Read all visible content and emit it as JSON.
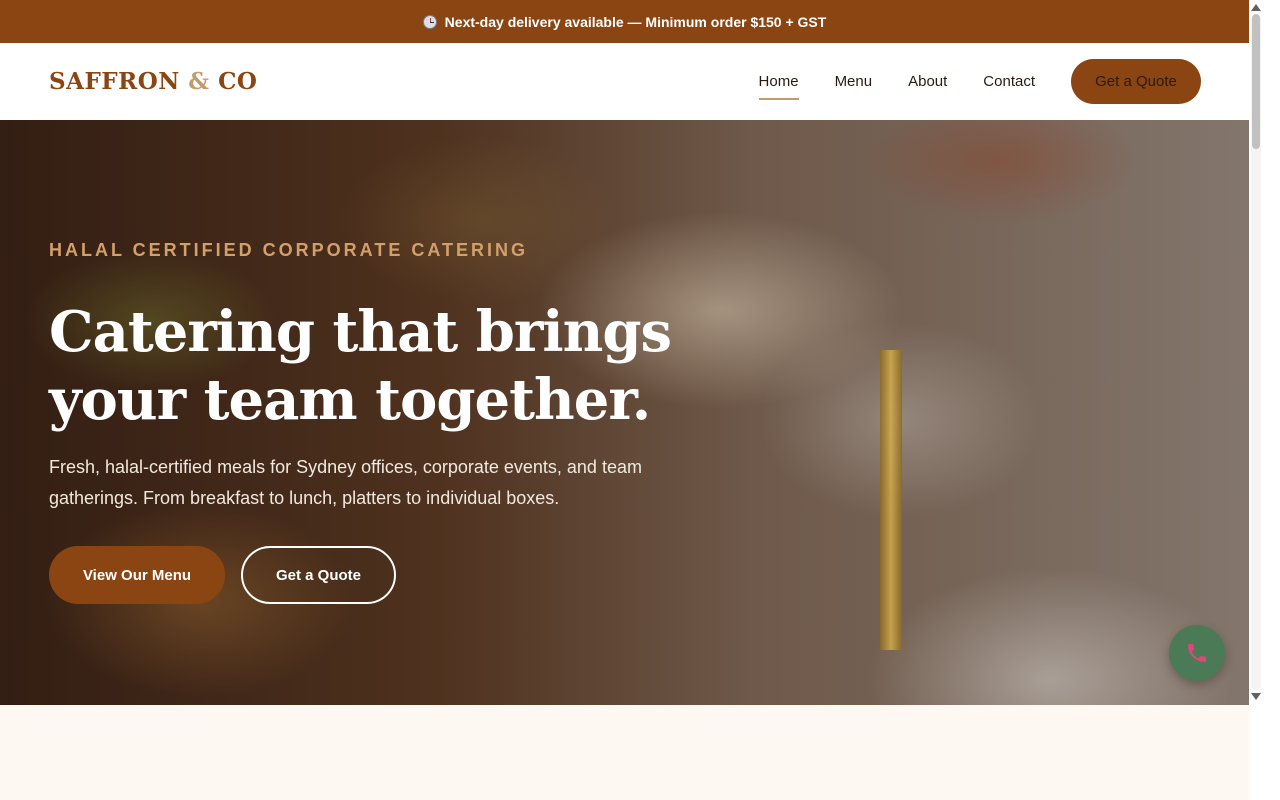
{
  "announcement": {
    "icon": "clock-icon",
    "text": "Next-day delivery available — Minimum order $150 + GST"
  },
  "header": {
    "logo": {
      "part1": "SAFFRON ",
      "amp": "&",
      "part2": " CO"
    },
    "nav": [
      {
        "label": "Home",
        "active": true
      },
      {
        "label": "Menu",
        "active": false
      },
      {
        "label": "About",
        "active": false
      },
      {
        "label": "Contact",
        "active": false
      }
    ],
    "cta_label": "Get a Quote"
  },
  "hero": {
    "eyebrow": "HALAL CERTIFIED CORPORATE CATERING",
    "title": "Catering that brings your team together.",
    "subtitle": "Fresh, halal-certified meals for Sydney offices, corporate events, and team gatherings. From breakfast to lunch, platters to individual boxes.",
    "primary_button": "View Our Menu",
    "secondary_button": "Get a Quote"
  },
  "floating_call": {
    "icon": "phone-icon"
  },
  "colors": {
    "brand": "#8b4513",
    "accent": "#c49a6c",
    "eyebrow": "#d4a06a",
    "call_button": "#4a7a56",
    "page_background": "#fdf8f2"
  }
}
